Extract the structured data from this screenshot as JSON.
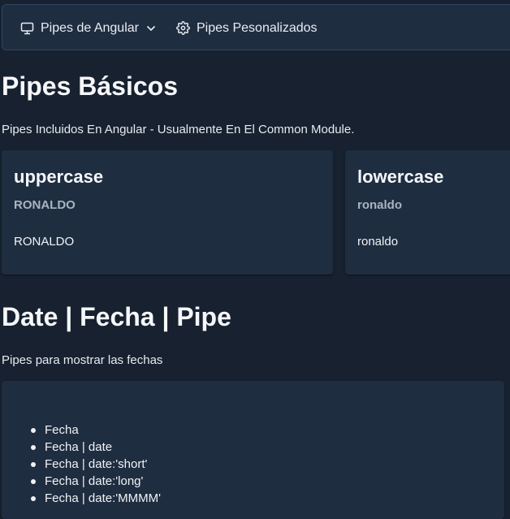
{
  "menubar": {
    "items": [
      {
        "label": "Pipes de Angular",
        "icon": "desktop-icon",
        "has_dropdown": true
      },
      {
        "label": "Pipes Pesonalizados",
        "icon": "gear-icon",
        "has_dropdown": false
      }
    ]
  },
  "basic": {
    "title": "Pipes Básicos",
    "description": "Pipes Incluidos En Angular - Usualmente En El Common Module.",
    "cards": [
      {
        "title": "uppercase",
        "subtitle": "RONALDO",
        "content": "RONALDO"
      },
      {
        "title": "lowercase",
        "subtitle": "ronaldo",
        "content": "ronaldo"
      }
    ]
  },
  "date": {
    "title": "Date | Fecha | Pipe",
    "description": "Pipes para mostrar las fechas",
    "items": [
      "Fecha",
      "Fecha | date",
      "Fecha | date:'short'",
      "Fecha | date:'long'",
      "Fecha | date:'MMMM'"
    ]
  },
  "colors": {
    "background": "#17212f",
    "surface": "#1f2d40",
    "border": "#304562",
    "text": "#f0f3f7",
    "muted": "#a9b4c2"
  }
}
